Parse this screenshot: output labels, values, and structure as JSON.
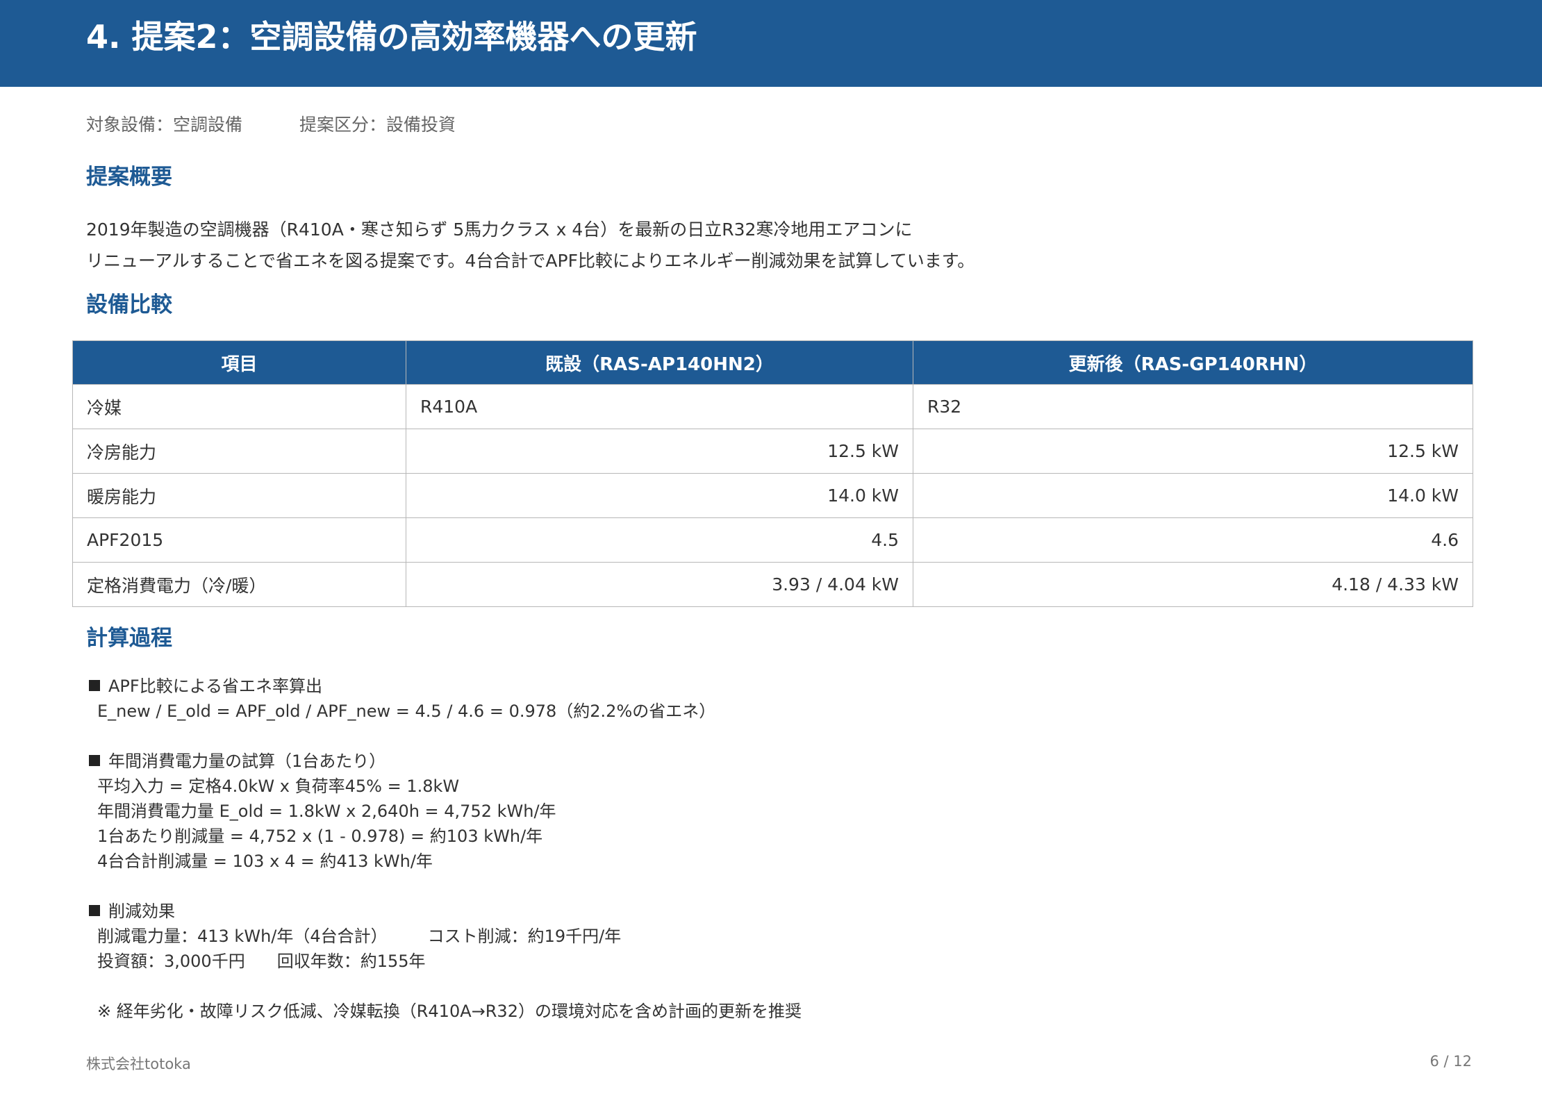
{
  "header": {
    "title": "4. 提案2：空調設備の高効率機器への更新"
  },
  "meta": {
    "target": "対象設備：空調設備",
    "category": "提案区分：設備投資"
  },
  "sections": {
    "summary_heading": "提案概要",
    "comparison_heading": "設備比較",
    "calc_heading": "計算過程"
  },
  "summary": {
    "line1": "2019年製造の空調機器（R410A・寒さ知らず 5馬力クラス x 4台）を最新の日立R32寒冷地用エアコンに",
    "line2": "リニューアルすることで省エネを図る提案です。4台合計でAPF比較によりエネルギー削減効果を試算しています。"
  },
  "table": {
    "headers": [
      "項目",
      "既設（RAS-AP140HN2）",
      "更新後（RAS-GP140RHN）"
    ],
    "rows": [
      [
        "冷媒",
        "R410A",
        "R32"
      ],
      [
        "冷房能力",
        "12.5 kW",
        "12.5 kW"
      ],
      [
        "暖房能力",
        "14.0 kW",
        "14.0 kW"
      ],
      [
        "APF2015",
        "4.5",
        "4.6"
      ],
      [
        "定格消費電力（冷/暖）",
        "3.93 / 4.04 kW",
        "4.18 / 4.33 kW"
      ]
    ]
  },
  "calc": {
    "block1": {
      "title": "APF比較による省エネ率算出",
      "lines": [
        "E_new / E_old = APF_old / APF_new = 4.5 / 4.6 = 0.978（約2.2%の省エネ）"
      ]
    },
    "block2": {
      "title": "年間消費電力量の試算（1台あたり）",
      "lines": [
        "平均入力 = 定格4.0kW x 負荷率45% = 1.8kW",
        "年間消費電力量 E_old = 1.8kW x 2,640h = 4,752 kWh/年",
        "1台あたり削減量 = 4,752 x (1 - 0.978) = 約103 kWh/年",
        "4台合計削減量 = 103 x 4 = 約413 kWh/年"
      ]
    },
    "block3": {
      "title": "削減効果",
      "reduction": "削減電力量：413 kWh/年（4台合計）",
      "cost": "コスト削減：約19千円/年",
      "investment": "投資額：3,000千円",
      "payback": "回収年数：約155年"
    },
    "note": "※ 経年劣化・故障リスク低減、冷媒転換（R410A→R32）の環境対応を含め計画的更新を推奨"
  },
  "footer": {
    "company": "株式会社totoka",
    "page": "6 / 12"
  }
}
